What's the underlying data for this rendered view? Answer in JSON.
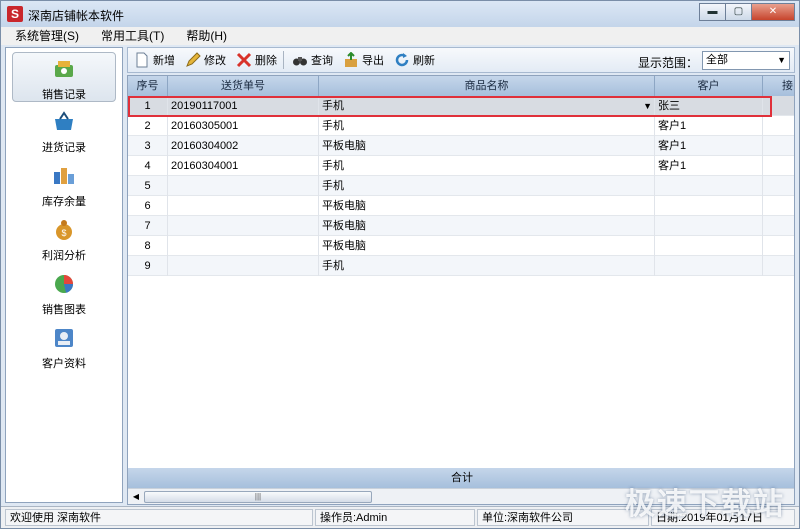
{
  "window": {
    "title": "深南店铺帐本软件",
    "icon_letter": "S",
    "min": "▬",
    "max": "▢",
    "close": "✕"
  },
  "menu": [
    "系统管理(S)",
    "常用工具(T)",
    "帮助(H)"
  ],
  "sidebar": [
    {
      "label": "销售记录",
      "icon": "sales-record-icon",
      "active": true
    },
    {
      "label": "进货记录",
      "icon": "purchase-record-icon",
      "active": false
    },
    {
      "label": "库存余量",
      "icon": "inventory-icon",
      "active": false
    },
    {
      "label": "利润分析",
      "icon": "profit-analysis-icon",
      "active": false
    },
    {
      "label": "销售图表",
      "icon": "sales-chart-icon",
      "active": false
    },
    {
      "label": "客户资料",
      "icon": "customer-info-icon",
      "active": false
    }
  ],
  "toolbar": {
    "new": "新增",
    "edit": "修改",
    "delete": "删除",
    "query": "查询",
    "export": "导出",
    "refresh": "刷新",
    "range_label": "显示范围：",
    "range_value": "全部"
  },
  "grid": {
    "columns": [
      "序号",
      "送货单号",
      "商品名称",
      "客户",
      "接"
    ],
    "rows": [
      [
        "1",
        "20190117001",
        "手机",
        "张三"
      ],
      [
        "2",
        "20160305001",
        "手机",
        "客户1"
      ],
      [
        "3",
        "20160304002",
        "平板电脑",
        "客户1"
      ],
      [
        "4",
        "20160304001",
        "手机",
        "客户1"
      ],
      [
        "5",
        "",
        "手机",
        ""
      ],
      [
        "6",
        "",
        "平板电脑",
        ""
      ],
      [
        "7",
        "",
        "平板电脑",
        ""
      ],
      [
        "8",
        "",
        "平板电脑",
        ""
      ],
      [
        "9",
        "",
        "手机",
        ""
      ]
    ],
    "total_label": "合计"
  },
  "status": {
    "welcome": "欢迎使用 深南软件",
    "operator": "操作员:Admin",
    "unit": "单位:深南软件公司",
    "date": "日期:2019年01月17日"
  },
  "watermark": "极速下载站",
  "colors": {
    "selection_outline": "#e0303a",
    "header": "#a6bfdc"
  }
}
